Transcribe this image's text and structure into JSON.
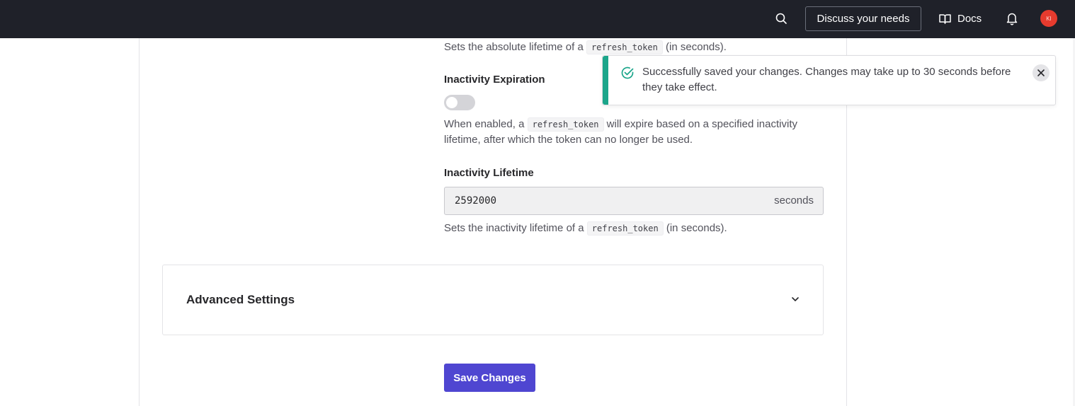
{
  "topbar": {
    "discuss_label": "Discuss your needs",
    "docs_label": "Docs",
    "avatar_initials": "KI",
    "avatar_color": "#e63b2e"
  },
  "absolute_lifetime": {
    "desc_prefix": "Sets the absolute lifetime of a ",
    "desc_code": "refresh_token",
    "desc_suffix": " (in seconds)."
  },
  "inactivity_expiration": {
    "label": "Inactivity Expiration",
    "enabled": false,
    "desc_prefix": "When enabled, a ",
    "desc_code": "refresh_token",
    "desc_suffix": " will expire based on a specified inactivity lifetime, after which the token can no longer be used."
  },
  "inactivity_lifetime": {
    "label": "Inactivity Lifetime",
    "value": "2592000",
    "unit": "seconds",
    "desc_prefix": "Sets the inactivity lifetime of a ",
    "desc_code": "refresh_token",
    "desc_suffix": " (in seconds)."
  },
  "advanced": {
    "title": "Advanced Settings"
  },
  "save_label": "Save Changes",
  "toast": {
    "message": "Successfully saved your changes. Changes may take up to 30 seconds before they take effect.",
    "accent_color": "#1ba58a"
  },
  "colors": {
    "primary": "#4f46d1",
    "topbar": "#1f2129"
  }
}
